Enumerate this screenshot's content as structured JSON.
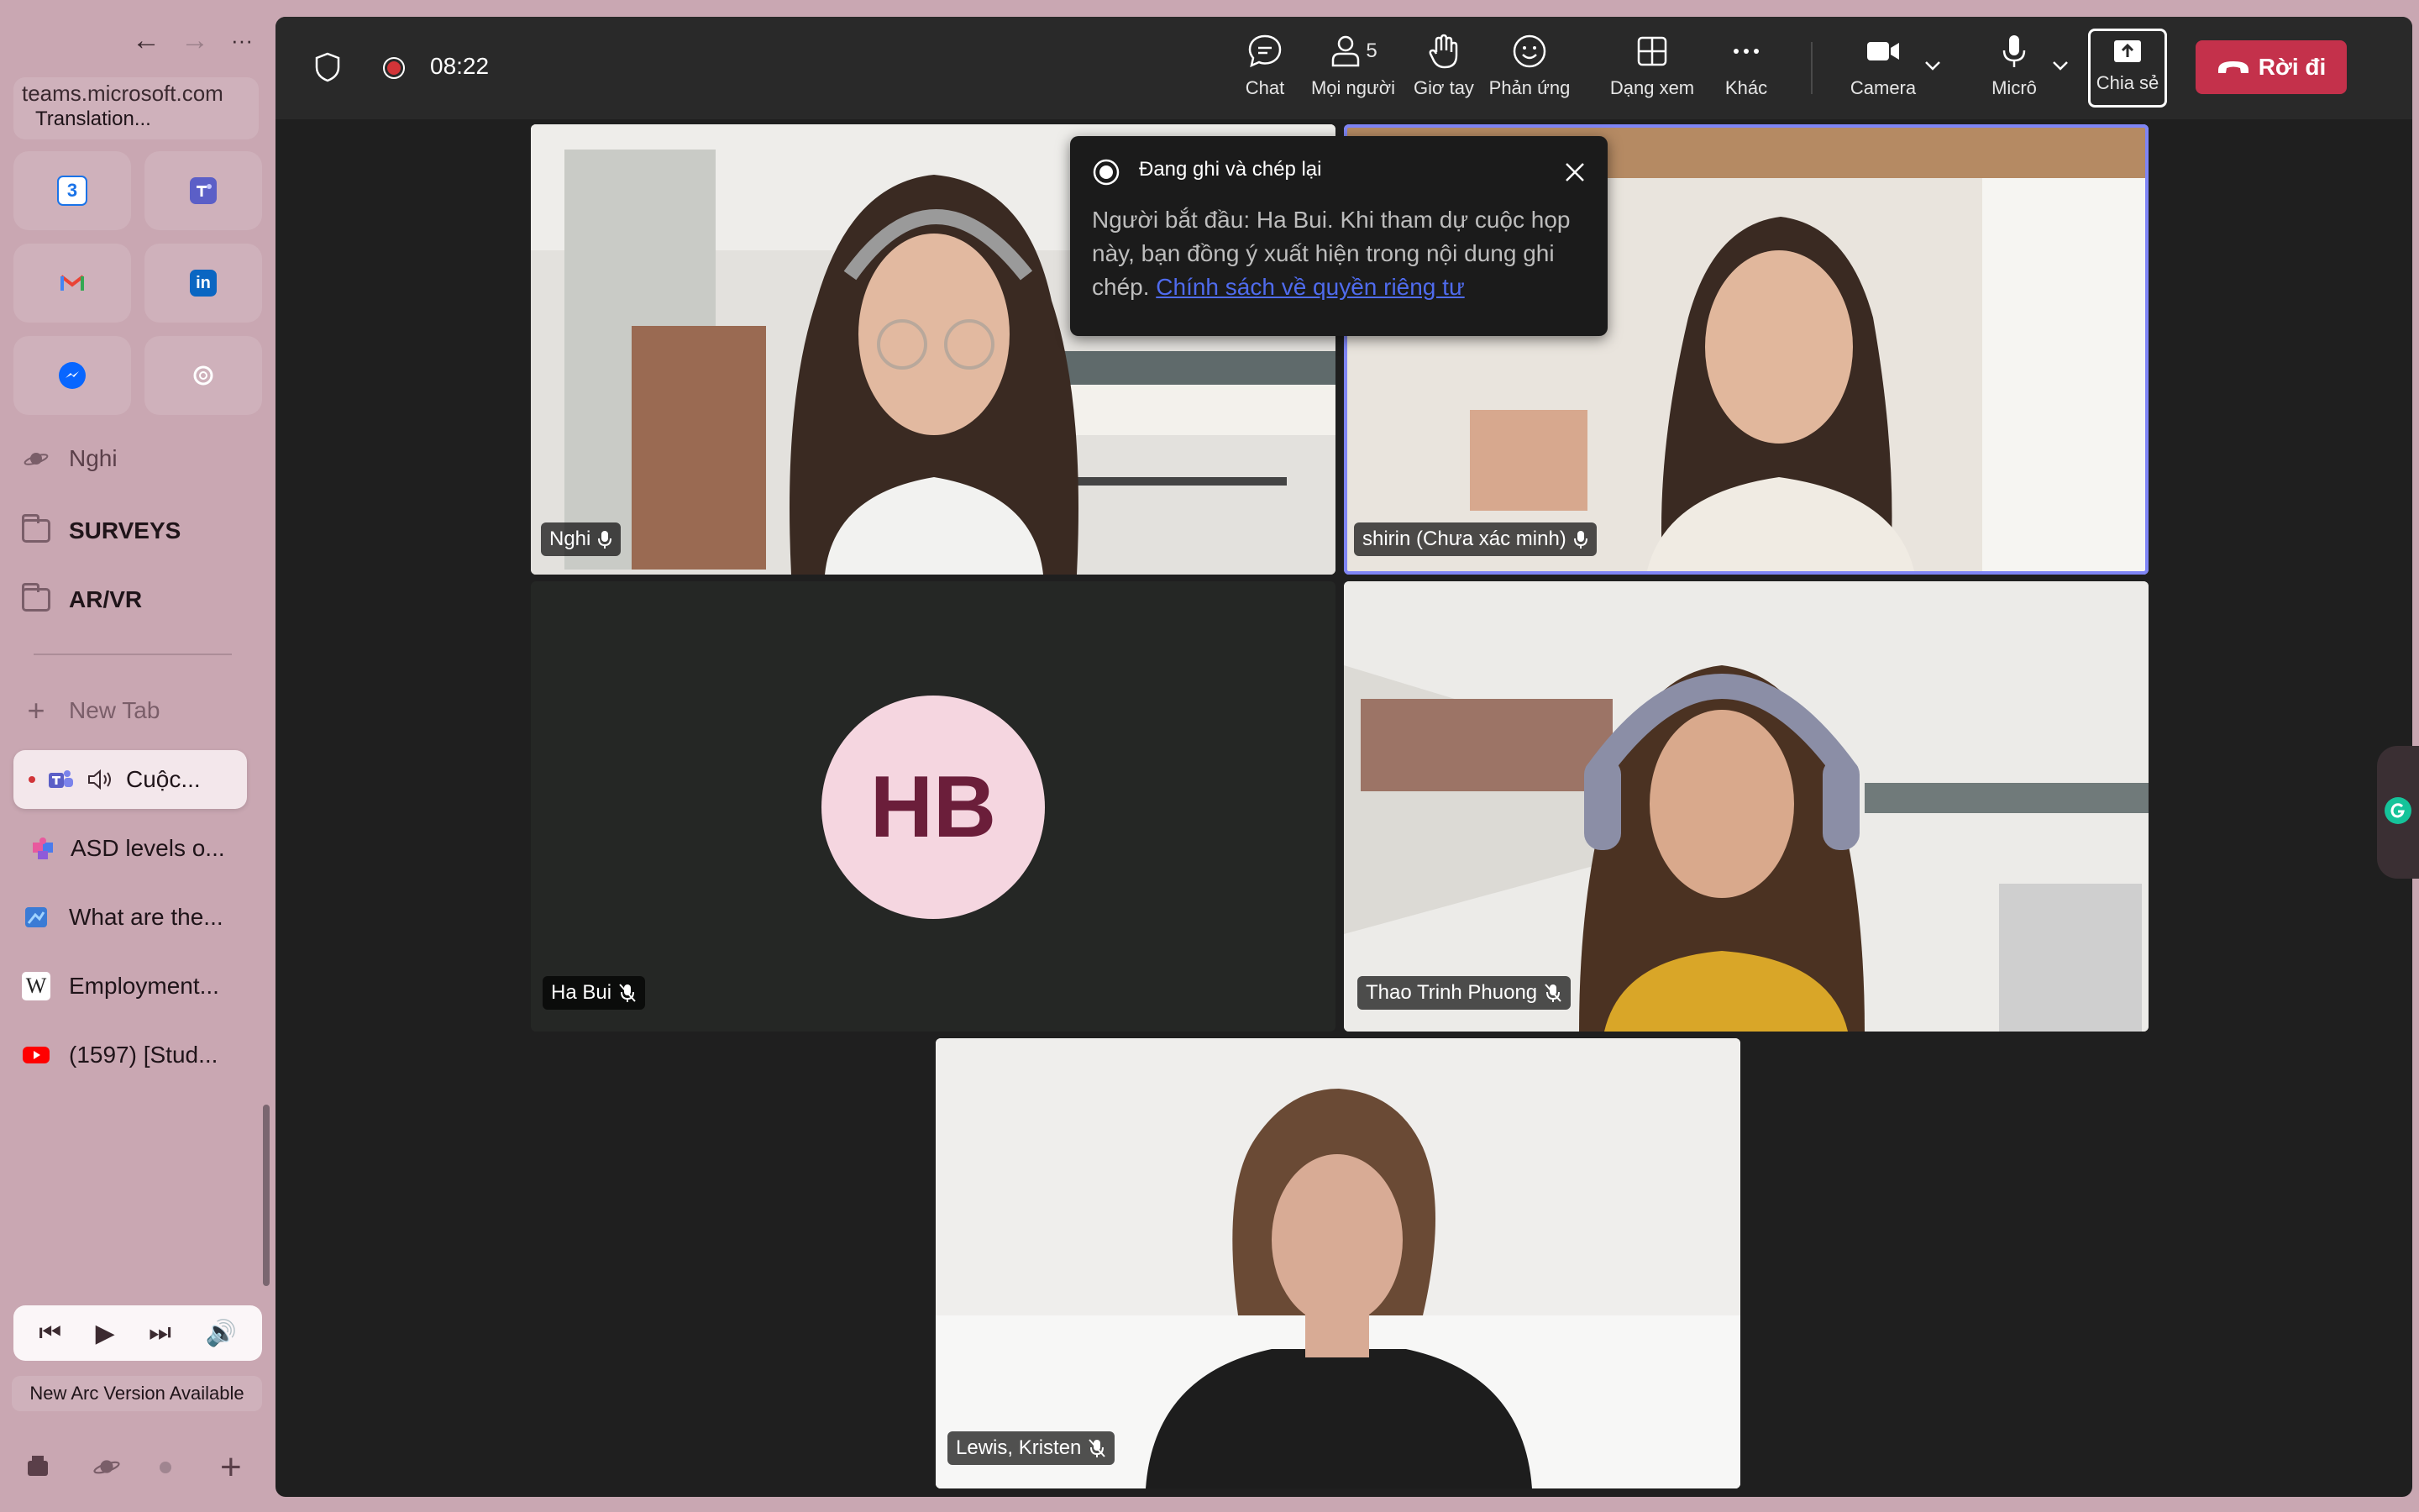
{
  "browser": {
    "url": "teams.microsoft.com",
    "page_title": "Translation...",
    "nav": {
      "back": "←",
      "forward": "→",
      "more": "···"
    }
  },
  "sidebar": {
    "favorites": [
      {
        "name": "calendar",
        "glyph": "3",
        "color": "#1a73e8"
      },
      {
        "name": "teams",
        "glyph": "",
        "color": "#5b5fc7"
      },
      {
        "name": "gmail",
        "glyph": "M",
        "color": "#ea4335"
      },
      {
        "name": "linkedin",
        "glyph": "in",
        "color": "#0a66c2"
      },
      {
        "name": "messenger",
        "glyph": "",
        "color": "#0866ff"
      },
      {
        "name": "chatgpt",
        "glyph": "",
        "color": "#6b6b6b"
      }
    ],
    "space": "Nghi",
    "folders": [
      "SURVEYS",
      "AR/VR"
    ],
    "new_tab": "New Tab",
    "tabs": [
      {
        "label": "Cuộc...",
        "active": true
      },
      {
        "label": "ASD levels o..."
      },
      {
        "label": "What are the..."
      },
      {
        "label": "Employment..."
      },
      {
        "label": "(1597) [Stud..."
      }
    ],
    "update_notice": "New Arc Version Available"
  },
  "meeting": {
    "timer": "08:22",
    "participant_count": "5",
    "toolbar": {
      "chat": "Chat",
      "people": "Mọi người",
      "raise_hand": "Giơ tay",
      "react": "Phản ứng",
      "view": "Dạng xem",
      "more": "Khác",
      "camera": "Camera",
      "mic": "Micrô",
      "share": "Chia sẻ",
      "leave": "Rời đi"
    },
    "participants": [
      {
        "name": "Nghi",
        "muted": false
      },
      {
        "name": "shirin (Chưa xác minh)",
        "muted": false,
        "speaking": true
      },
      {
        "name": "Ha Bui",
        "muted": true,
        "initials": "HB"
      },
      {
        "name": "Thao Trinh Phuong",
        "muted": true
      },
      {
        "name": "Lewis, Kristen",
        "muted": true
      }
    ],
    "recording_notice": {
      "title": "Đang ghi và chép lại",
      "body": "Người bắt đầu: Ha Bui. Khi tham dự cuộc họp này, bạn đồng ý xuất hiện trong nội dung ghi chép.",
      "link": "Chính sách về quyền riêng tư"
    }
  },
  "colors": {
    "arc_bg": "#c9a7b2",
    "teams_bg": "#1f1f1f",
    "leave_red": "#c4314b",
    "speaking_border": "#7f85f5",
    "avatar_bg": "#f5d6e0",
    "avatar_text": "#6b1e3a"
  }
}
